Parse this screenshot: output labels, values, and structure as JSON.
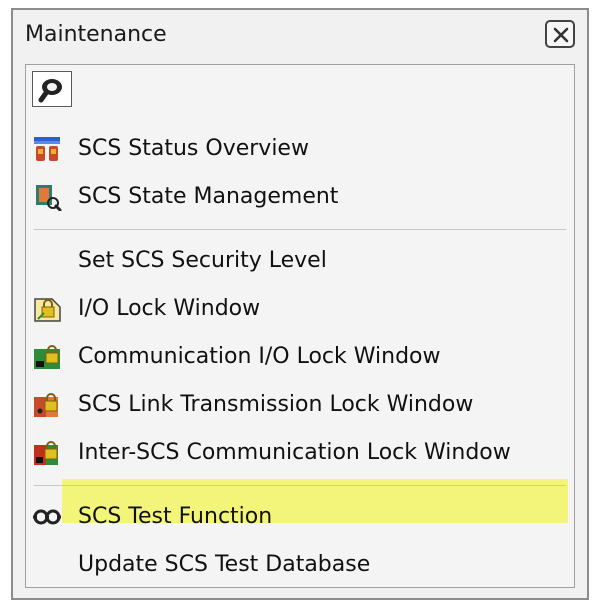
{
  "window": {
    "title": "Maintenance",
    "close_icon": "close-icon"
  },
  "toolbar": {
    "icon": "magnifier-icon"
  },
  "menu": {
    "items": [
      {
        "label": "SCS Status Overview",
        "icon": "status-overview-icon"
      },
      {
        "label": "SCS State Management",
        "icon": "state-management-icon"
      },
      {
        "label": "Set SCS Security Level",
        "icon": ""
      },
      {
        "label": "I/O Lock Window",
        "icon": "io-lock-icon"
      },
      {
        "label": "Communication I/O Lock Window",
        "icon": "communication-io-lock-icon"
      },
      {
        "label": "SCS Link Transmission Lock Window",
        "icon": "link-transmission-lock-icon"
      },
      {
        "label": "Inter-SCS Communication Lock Window",
        "icon": "inter-scs-lock-icon",
        "highlighted": true
      },
      {
        "label": "SCS Test Function",
        "icon": "test-function-icon"
      },
      {
        "label": "Update SCS Test Database",
        "icon": ""
      }
    ]
  },
  "colors": {
    "highlight": "#f2f57a",
    "lock_yellow": "#e0c020",
    "lock_green": "#2e8b3a",
    "lock_red": "#c0301c"
  }
}
